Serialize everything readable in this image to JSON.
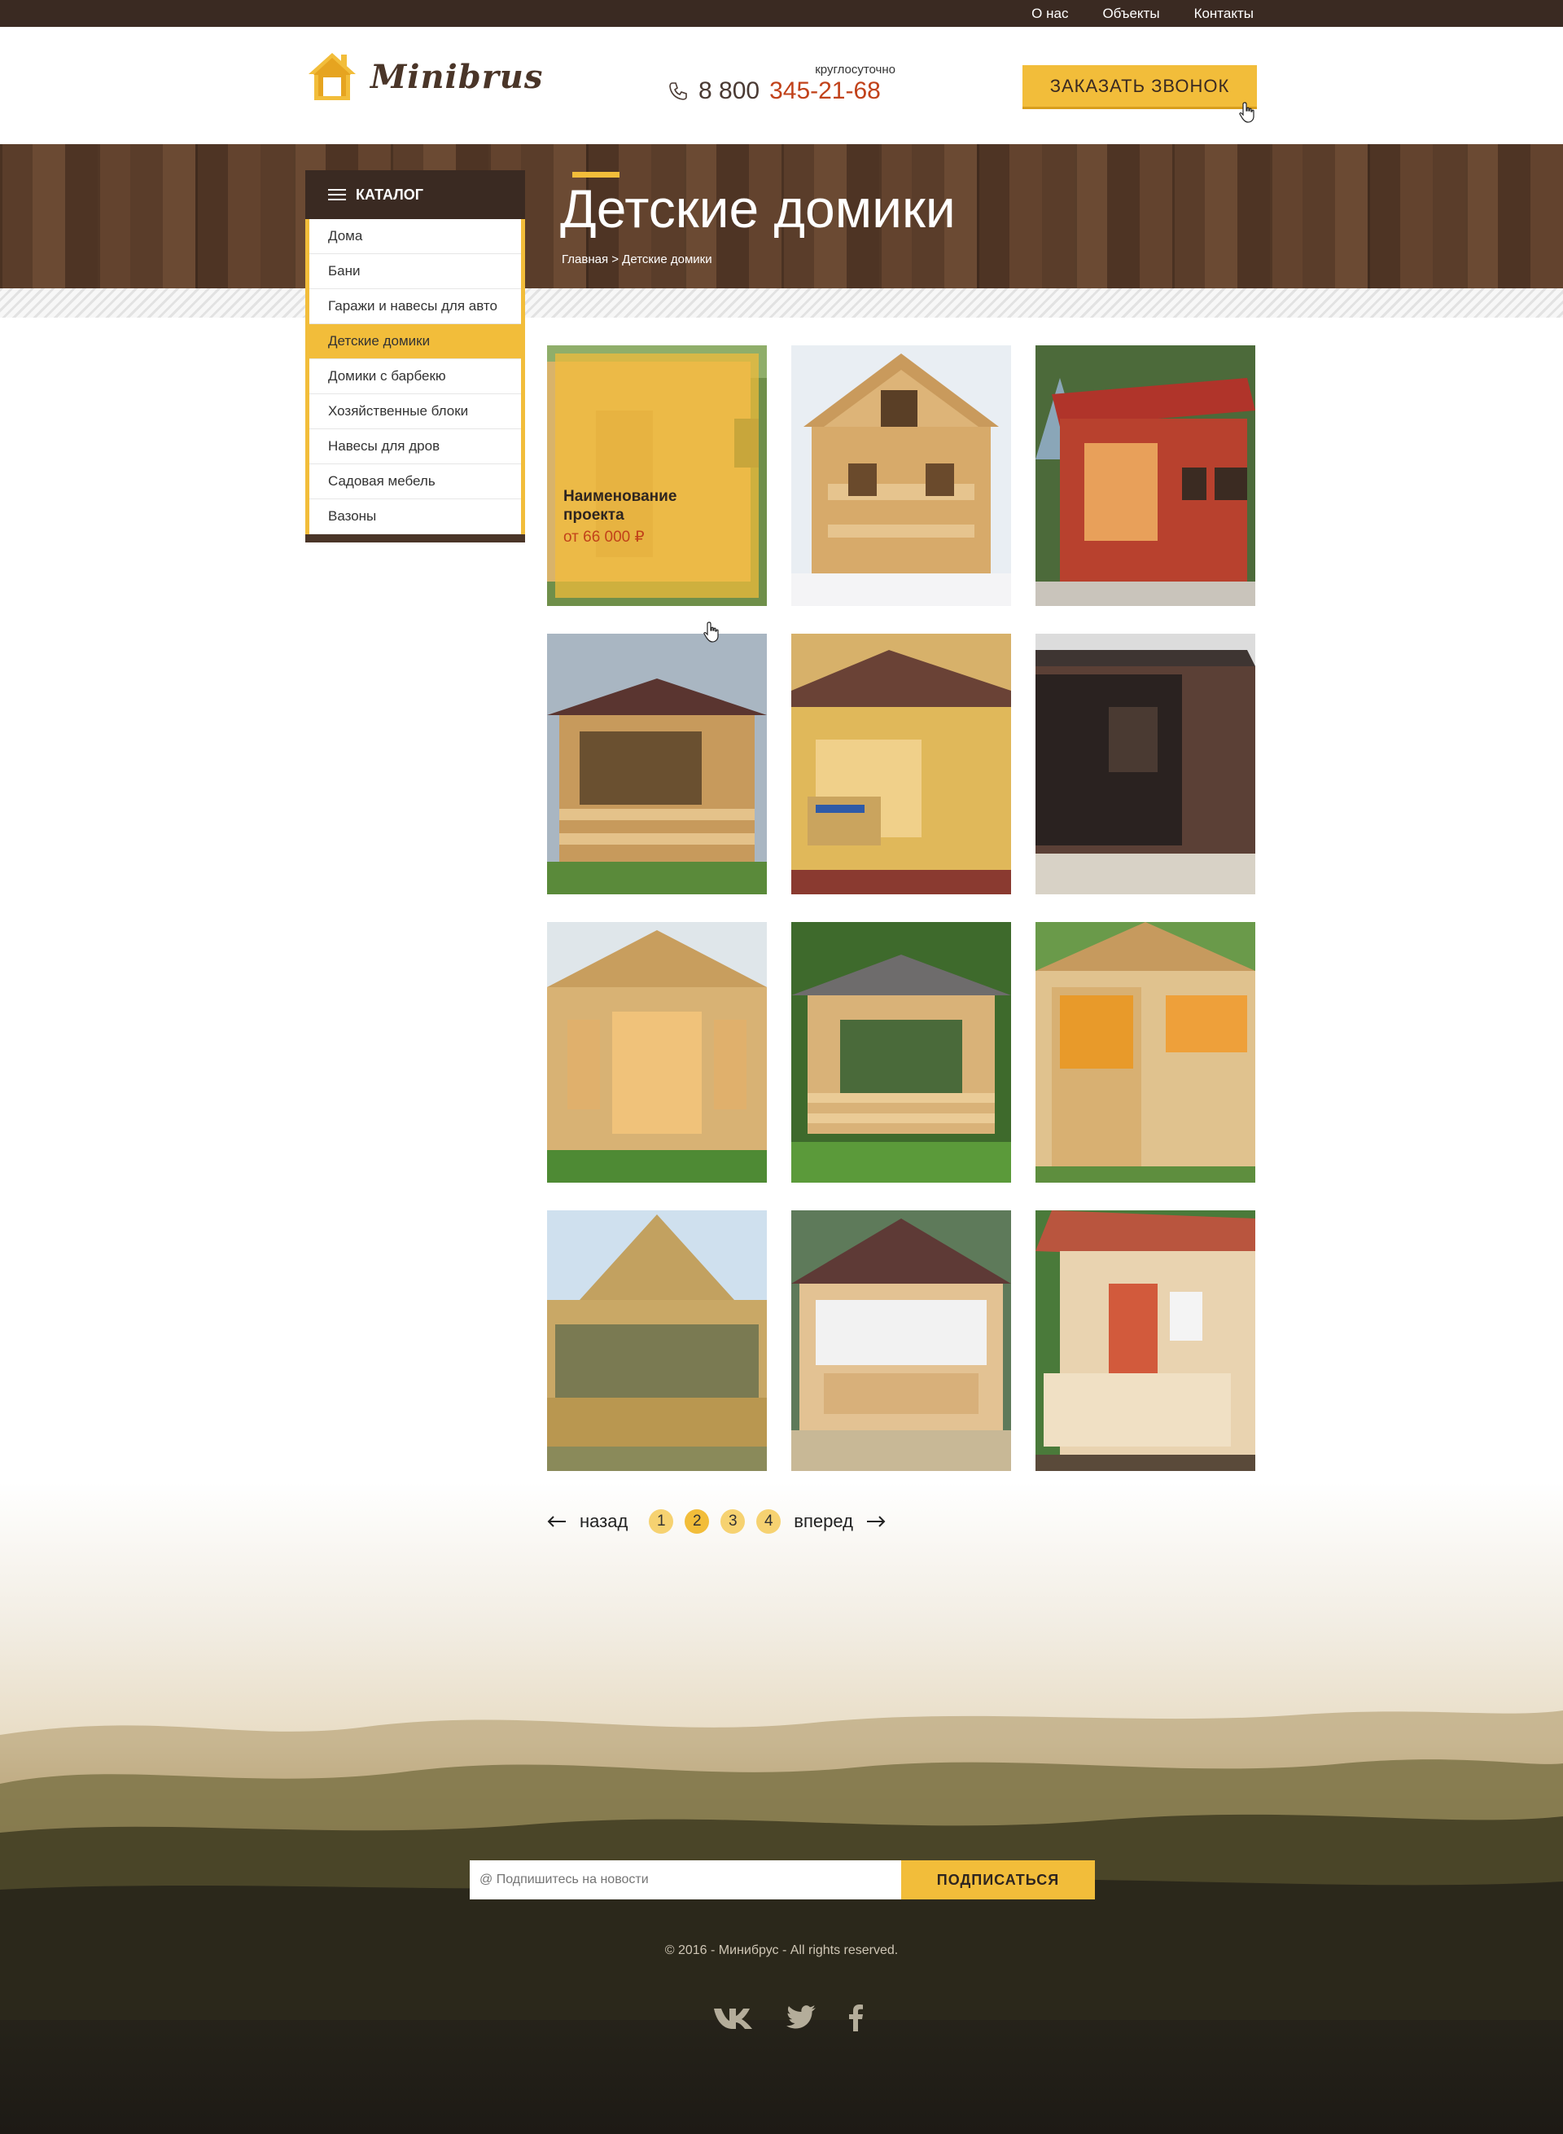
{
  "topnav": {
    "items": [
      "О нас",
      "Объекты",
      "Контакты"
    ]
  },
  "header": {
    "logo_text": "Minibrus",
    "phone_note": "круглосуточно",
    "phone_prefix": "8 800",
    "phone_main": "345-21-68",
    "callback_label": "ЗАКАЗАТЬ ЗВОНОК"
  },
  "hero": {
    "title": "Детские домики",
    "breadcrumb": "Главная > Детские домики"
  },
  "catalog": {
    "title": "КАТАЛОГ",
    "items": [
      "Дома",
      "Бани",
      "Гаражи и навесы для авто",
      "Детские домики",
      "Домики с барбекю",
      "Хозяйственные блоки",
      "Навесы для дров",
      "Садовая мебель",
      "Вазоны"
    ],
    "active_index": 3
  },
  "products": {
    "hover_card": {
      "name": "Наименование проекта",
      "price": "от 66 000 ₽"
    }
  },
  "pagination": {
    "prev_label": "назад",
    "next_label": "вперед",
    "pages": [
      "1",
      "2",
      "3",
      "4"
    ],
    "current": "2"
  },
  "footer": {
    "subscribe_placeholder": "@ Подпишитесь на новости",
    "subscribe_button": "ПОДПИСАТЬСЯ",
    "copyright": "© 2016 - Минибрус - All rights reserved.",
    "social_icons": [
      "vk-icon",
      "twitter-icon",
      "facebook-icon"
    ]
  },
  "colors": {
    "accent": "#f2bd3a",
    "dark": "#3a2a22",
    "phone_accent": "#c1421a"
  }
}
